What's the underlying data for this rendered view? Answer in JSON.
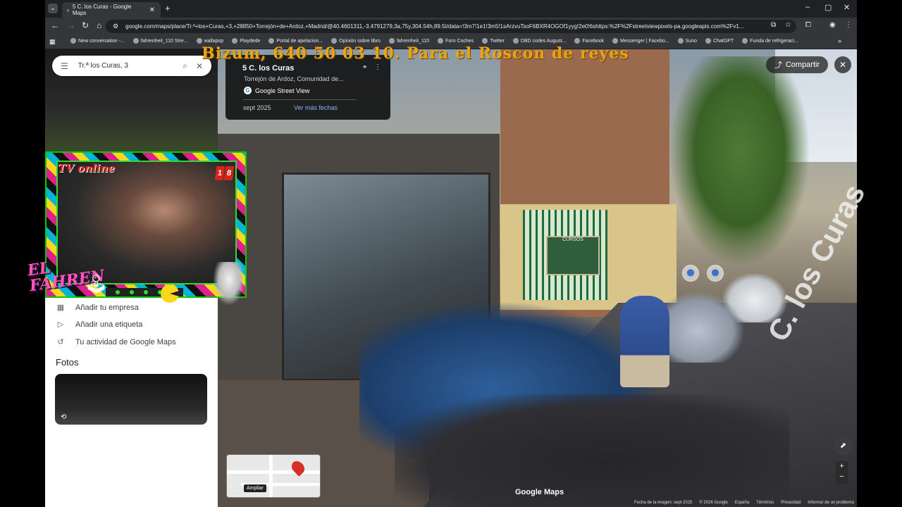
{
  "browser": {
    "tab_title": "5 C. los Curas - Google Maps",
    "url": "google.com/maps/place/Tr.ª+los+Curas,+3,+28850+Torrejón+de+Ardoz,+Madrid/@40.4601311,-3.4791279,3a,75y,304.54h,89.5t/data=!3m7!1e1!3m5!1sArzvuTsoF6BXR4OGOf1yyg!2e0!6shttps:%2F%2Fstreetviewpixels-pa.googleapis.com%2Fv1...",
    "bookmarks": [
      "New conversation -...",
      "fahrenheit_110 Stre...",
      "wallapop",
      "Playdede",
      "Portal de apelacion...",
      "Opinión sobre libro",
      "fahrenheit_110",
      "Foro Coches",
      "Twitter",
      "DBD codes August...",
      "Facebook",
      "Messenger | Facebo...",
      "Suno",
      "ChatGPT",
      "Funda de refrigeraci..."
    ]
  },
  "overlay": {
    "marquee": "Bizum, 640 50 03 10. Para el Roscon de reyes",
    "tv_label": "TV online",
    "badge": [
      "1",
      "8"
    ],
    "logo_line1": "EL",
    "logo_line2": "FAHREN"
  },
  "search": {
    "query": "Tr.ª los Curas, 3"
  },
  "sidebar": {
    "items": [
      {
        "label": "Añadir tu empresa",
        "icon": "business-icon"
      },
      {
        "label": "Añadir una etiqueta",
        "icon": "label-icon"
      },
      {
        "label": "Tu actividad de Google Maps",
        "icon": "history-icon"
      }
    ],
    "photos_heading": "Fotos"
  },
  "streetview": {
    "title": "5 C. los Curas",
    "subtitle": "Torrejón de Ardoz, Comunidad de...",
    "brand": "Google Street View",
    "date": "sept 2025",
    "more_dates": "Ver más fechas",
    "share": "Compartir",
    "board_text": "CURSOS",
    "street_name": "C. los Curas",
    "logo": "Google Maps",
    "expand_tooltip": "Ampliar",
    "footer": [
      "Fecha de la imagen: sept 2025",
      "© 2026 Google",
      "España",
      "Términos",
      "Privacidad",
      "Informar de un problema"
    ],
    "zoom_in": "+",
    "zoom_out": "−"
  },
  "colors": {
    "marquee": "#e8a414",
    "link": "#8ab4f8",
    "chrome": "#35363a"
  }
}
